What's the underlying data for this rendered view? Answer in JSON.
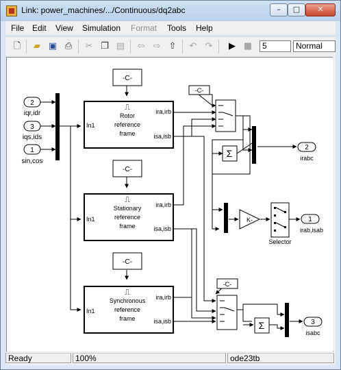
{
  "window": {
    "title": "Link: power_machines/.../Continuous/dq2abc",
    "buttons": {
      "minimize": "–",
      "maximize": "□",
      "close": "✕"
    }
  },
  "menu": [
    "File",
    "Edit",
    "View",
    "Simulation",
    "Format",
    "Tools",
    "Help"
  ],
  "menu_disabled": [
    "Format"
  ],
  "toolbar": {
    "icons": [
      "new-icon",
      "open-icon",
      "save-icon",
      "print-icon",
      "cut-icon",
      "copy-icon",
      "paste-icon",
      "back-icon",
      "forward-icon",
      "up-icon",
      "undo-icon",
      "redo-icon",
      "play-icon",
      "stop-icon"
    ],
    "stop_time": "5",
    "sim_mode": "Normal"
  },
  "diagram": {
    "inports": [
      {
        "num": "2",
        "label": "iqr,idr"
      },
      {
        "num": "3",
        "label": "iqs,ids"
      },
      {
        "num": "1",
        "label": "sin,cos"
      }
    ],
    "constants": [
      "-C-",
      "-C-",
      "-C-",
      "-C-",
      "-C-"
    ],
    "subsystems": [
      {
        "title": "Rotor\nreference\nframe",
        "in_port": "In1",
        "out1": "ira,irb",
        "out2": "isa,isb"
      },
      {
        "title": "Stationary\nreference\nframe",
        "in_port": "In1",
        "out1": "ira,irb",
        "out2": "isa,isb"
      },
      {
        "title": "Synchronous\nreference\nframe",
        "in_port": "In1",
        "out1": "ira,irb",
        "out2": "isa,isb"
      }
    ],
    "gain_label": "K-",
    "selector_label": "Selector",
    "sum_symbol": "Σ",
    "step_symbol": "⎍",
    "outports": [
      {
        "num": "2",
        "label": "irabc"
      },
      {
        "num": "1",
        "label": "irab,isab"
      },
      {
        "num": "3",
        "label": "isabc"
      }
    ]
  },
  "status": {
    "state": "Ready",
    "zoom": "100%",
    "solver": "ode23tb"
  }
}
